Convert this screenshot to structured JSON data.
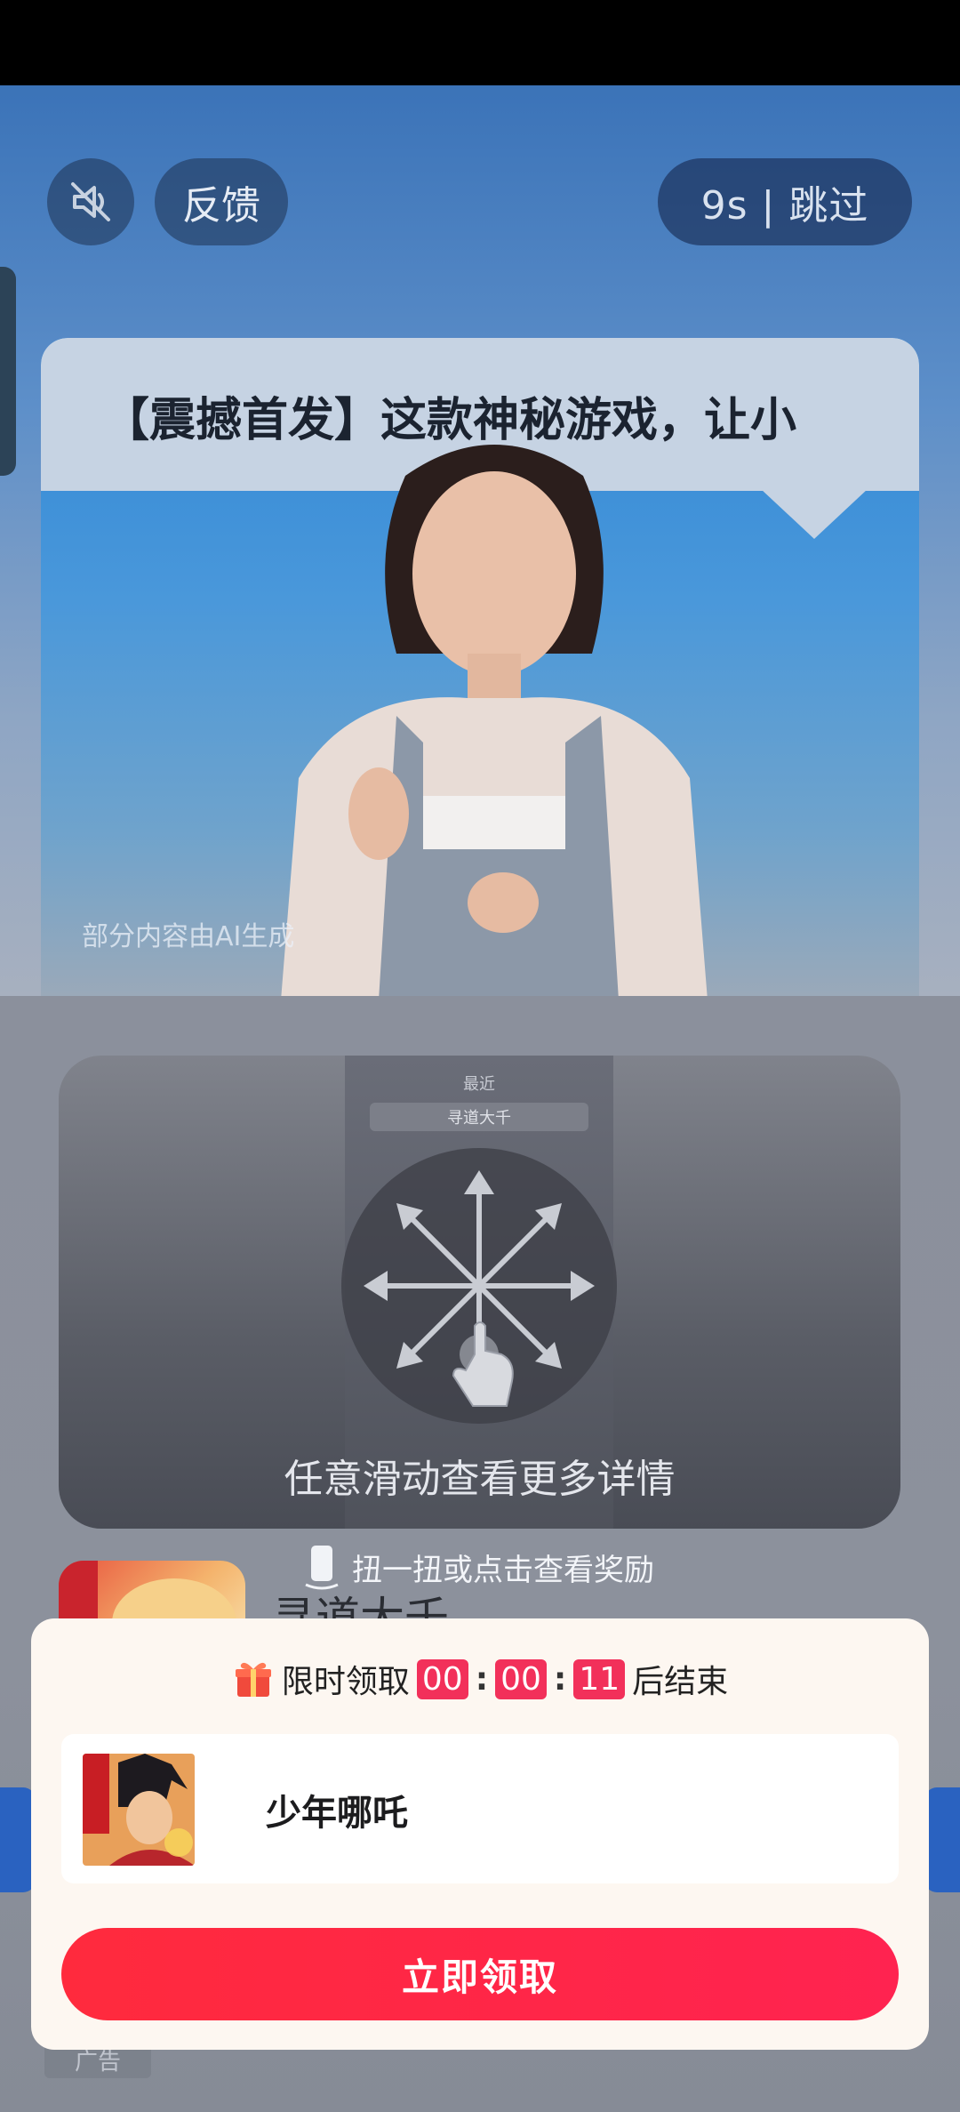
{
  "controls": {
    "mute_icon": "speaker-muted-icon",
    "feedback_label": "反馈",
    "skip_label": "9s | 跳过"
  },
  "ad": {
    "headline": "【震撼首发】这款神秘游戏，让小",
    "ai_note": "部分内容由AI生成"
  },
  "swipe_guide": {
    "preview_recent": "最近",
    "preview_search": "寻道大千",
    "instruction": "任意滑动查看更多详情"
  },
  "twist_hint": "扭一扭或点击查看奖励",
  "app_title": "寻道大千",
  "ad_tag": "广告",
  "popup": {
    "prefix": "限时领取",
    "hours": "00",
    "minutes": "00",
    "seconds": "11",
    "suffix": "后结束",
    "game_name": "少年哪吒",
    "claim_label": "立即领取"
  },
  "colors": {
    "accent": "#ff2a3d",
    "timer": "#f2305a"
  }
}
